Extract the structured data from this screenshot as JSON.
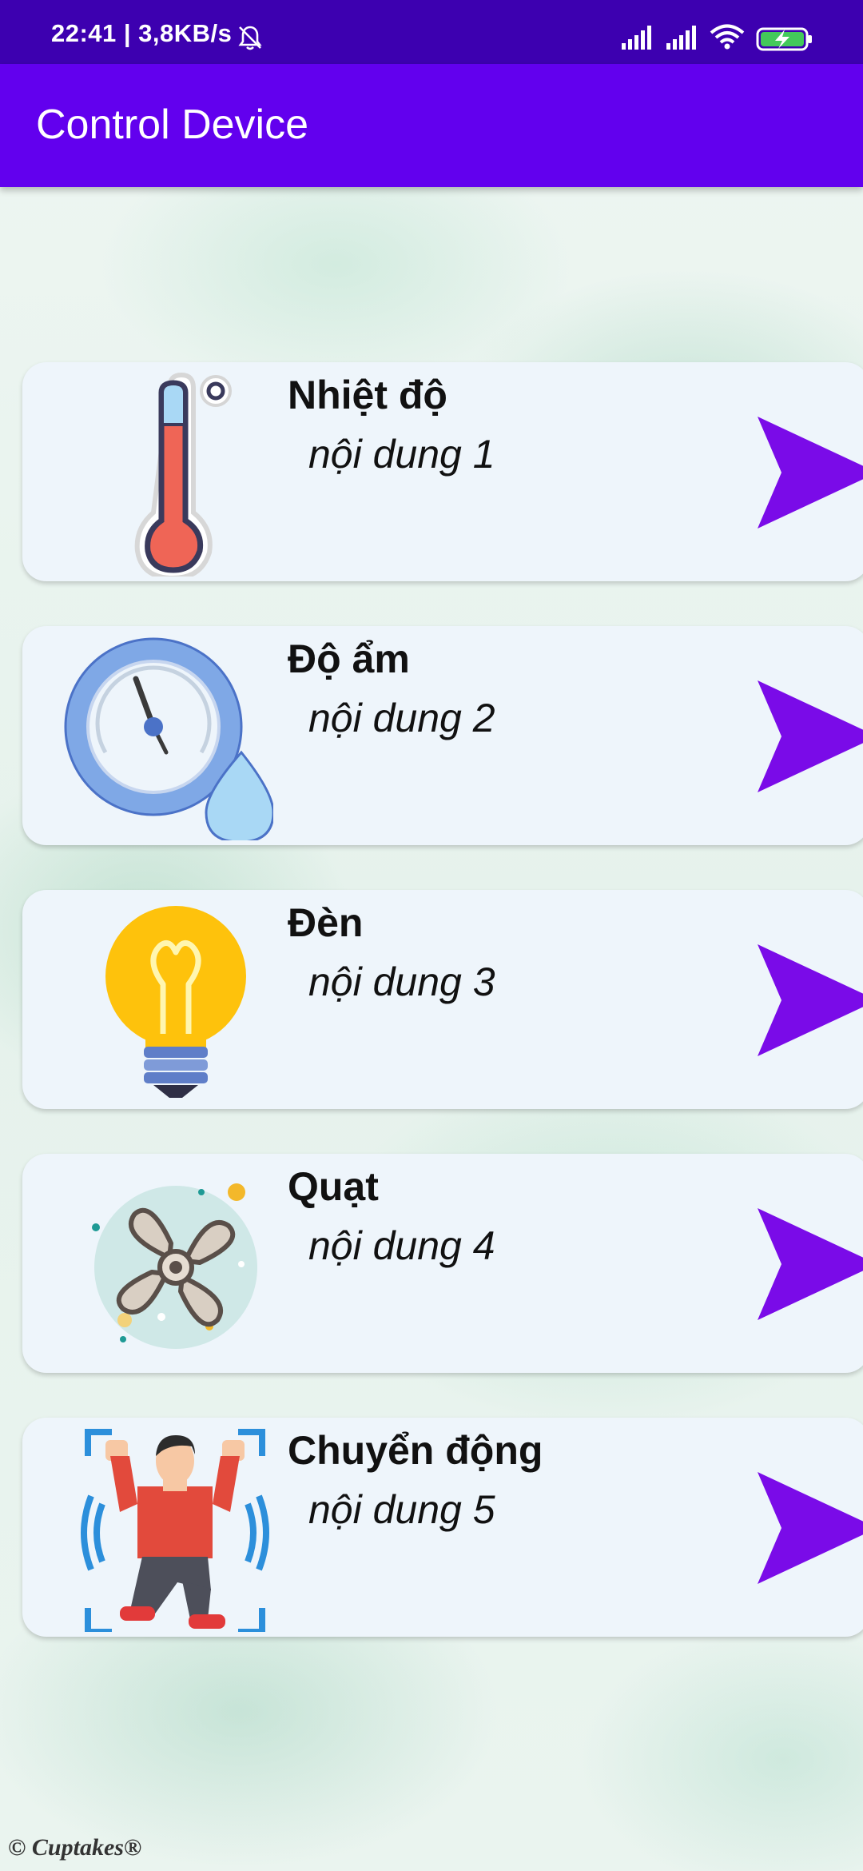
{
  "status_bar": {
    "time_speed": "22:41 | 3,8KB/s"
  },
  "app_bar": {
    "title": "Control Device"
  },
  "devices": [
    {
      "title": "Nhiệt độ",
      "subtitle": "nội dung 1",
      "icon": "thermometer-icon"
    },
    {
      "title": "Độ ẩm",
      "subtitle": "nội dung 2",
      "icon": "humidity-gauge-icon"
    },
    {
      "title": "Đèn",
      "subtitle": "nội dung 3",
      "icon": "light-bulb-icon"
    },
    {
      "title": "Quạt",
      "subtitle": "nội dung 4",
      "icon": "fan-icon"
    },
    {
      "title": "Chuyển động",
      "subtitle": "nội dung 5",
      "icon": "motion-icon"
    }
  ],
  "watermark": "© Cuptakes®",
  "colors": {
    "status_bar": "#3d00b0",
    "app_bar": "#6200ee",
    "arrow": "#7a0be8",
    "card": "#eef5fb"
  }
}
